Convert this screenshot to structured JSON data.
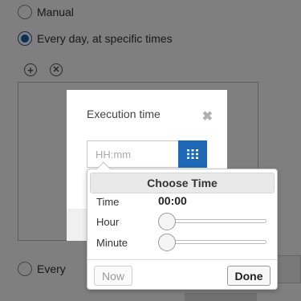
{
  "schedule": {
    "options": [
      {
        "label": "Manual",
        "checked": false
      },
      {
        "label": "Every day, at specific times",
        "checked": true
      },
      {
        "label": "Every",
        "checked": false
      }
    ],
    "toolbar_icons": [
      "add-icon",
      "remove-icon"
    ]
  },
  "modal": {
    "title": "Execution time",
    "close_icon": "close-icon",
    "time_input_placeholder": "HH:mm",
    "time_input_value": "",
    "picker_icon": "grid-icon"
  },
  "time_picker": {
    "header": "Choose Time",
    "time_label": "Time",
    "time_value": "00:00",
    "hour_label": "Hour",
    "hour_value": 0,
    "minute_label": "Minute",
    "minute_value": 0,
    "now_label": "Now",
    "done_label": "Done"
  },
  "colors": {
    "accent": "#1d67b5",
    "overlay": "rgba(0,0,0,0.5)"
  }
}
